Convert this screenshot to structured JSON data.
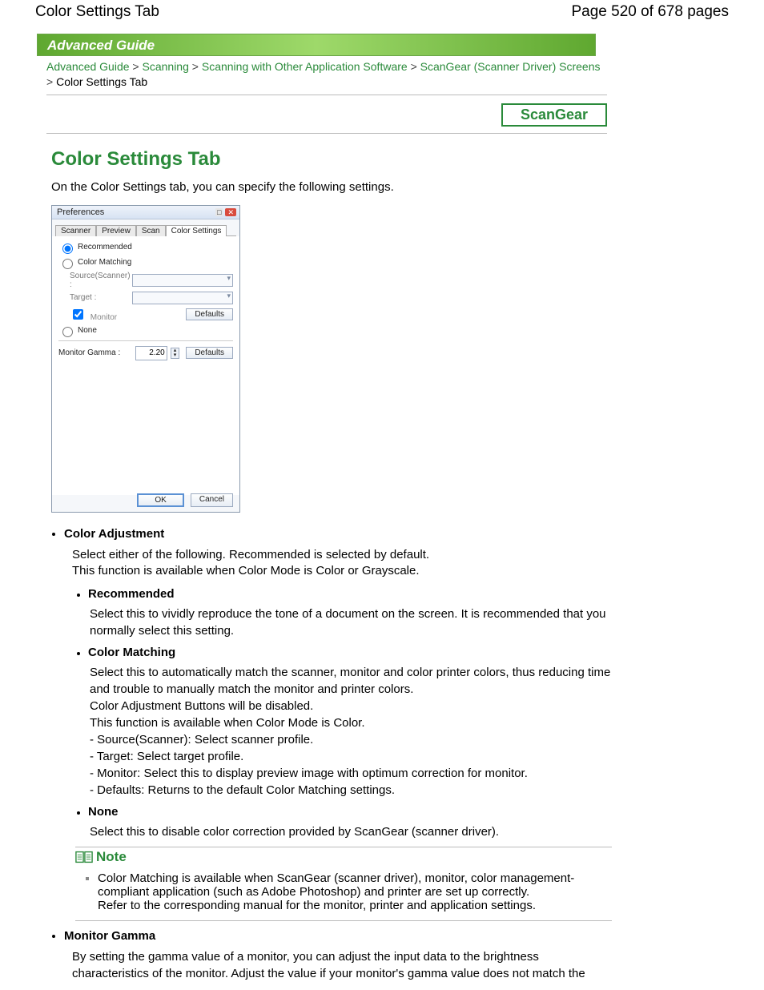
{
  "header": {
    "left": "Color Settings Tab",
    "right": "Page 520 of 678 pages"
  },
  "banner": "Advanced Guide",
  "breadcrumb": {
    "items": [
      "Advanced Guide",
      "Scanning",
      "Scanning with Other Application Software",
      "ScanGear (Scanner Driver) Screens"
    ],
    "tail": "Color Settings Tab",
    "sep": ">"
  },
  "scangear_box": "ScanGear",
  "page_title": "Color Settings Tab",
  "intro": "On the Color Settings tab, you can specify the following settings.",
  "dialog": {
    "title": "Preferences",
    "tabs": [
      "Scanner",
      "Preview",
      "Scan",
      "Color Settings"
    ],
    "active_tab": 3,
    "recommended": "Recommended",
    "color_matching": "Color Matching",
    "source_label": "Source(Scanner) :",
    "target_label": "Target :",
    "monitor_cb": "Monitor",
    "defaults_btn": "Defaults",
    "none": "None",
    "gamma_label": "Monitor Gamma :",
    "gamma_value": "2.20",
    "ok": "OK",
    "cancel": "Cancel"
  },
  "content": {
    "color_adjustment": {
      "title": "Color Adjustment",
      "body": "Select either of the following. Recommended is selected by default.\nThis function is available when Color Mode is Color or Grayscale.",
      "recommended": {
        "title": "Recommended",
        "body": "Select this to vividly reproduce the tone of a document on the screen. It is recommended that you normally select this setting."
      },
      "color_matching": {
        "title": "Color Matching",
        "body": "Select this to automatically match the scanner, monitor and color printer colors, thus reducing time and trouble to manually match the monitor and printer colors.\nColor Adjustment Buttons will be disabled.\nThis function is available when Color Mode is Color.\n- Source(Scanner): Select scanner profile.\n- Target: Select target profile.\n- Monitor: Select this to display preview image with optimum correction for monitor.\n- Defaults: Returns to the default Color Matching settings."
      },
      "none": {
        "title": "None",
        "body": "Select this to disable color correction provided by ScanGear (scanner driver)."
      }
    },
    "note": {
      "title": "Note",
      "body": "Color Matching is available when ScanGear (scanner driver), monitor, color management-compliant application (such as Adobe Photoshop) and printer are set up correctly.\nRefer to the corresponding manual for the monitor, printer and application settings."
    },
    "monitor_gamma": {
      "title": "Monitor Gamma",
      "body": "By setting the gamma value of a monitor, you can adjust the input data to the brightness characteristics of the monitor. Adjust the value if your monitor's gamma value does not match the"
    }
  }
}
